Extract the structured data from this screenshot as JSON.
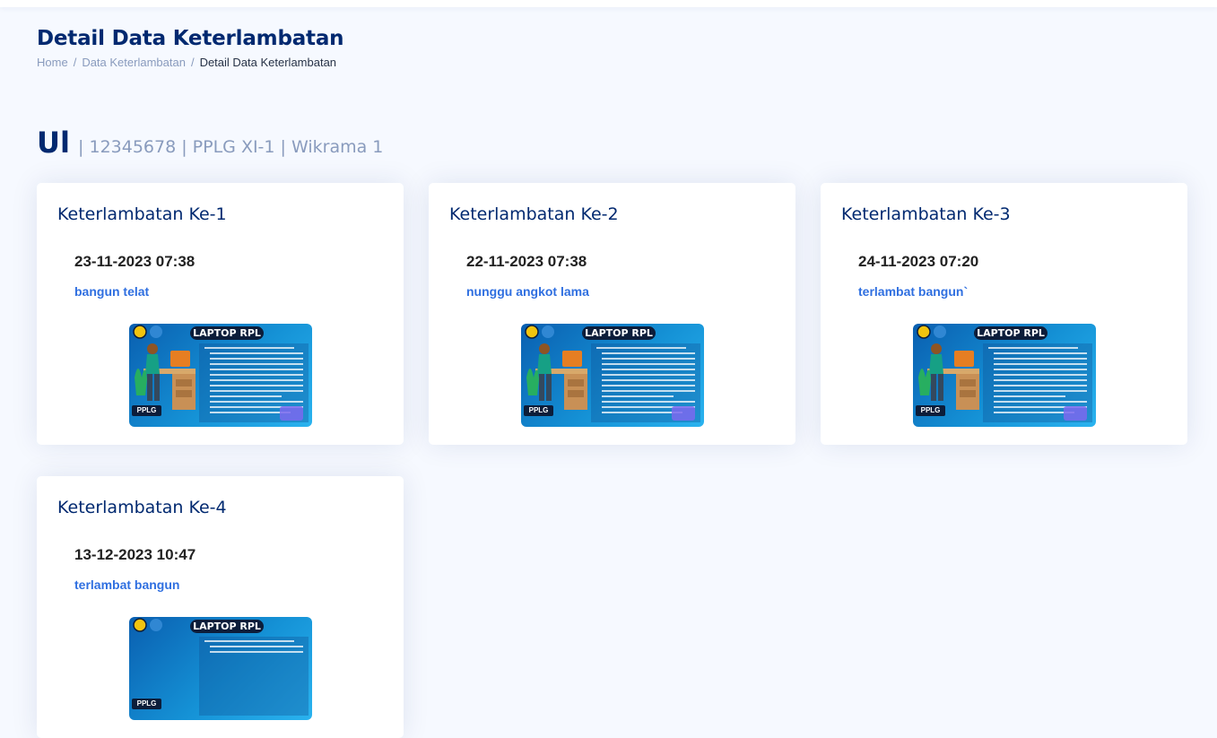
{
  "page": {
    "title": "Detail Data Keterlambatan",
    "breadcrumb": [
      "Home",
      "Data Keterlambatan",
      "Detail Data Keterlambatan"
    ]
  },
  "student": {
    "name": "Ul",
    "details": "| 12345678 | PPLG XI-1 | Wikrama 1"
  },
  "cards": [
    {
      "title": "Keterlambatan Ke-1",
      "datetime": "23-11-2023 07:38",
      "reason": "bangun telat",
      "image": {
        "title": "LAPTOP RPL",
        "tag": "PPLG"
      }
    },
    {
      "title": "Keterlambatan Ke-2",
      "datetime": "22-11-2023 07:38",
      "reason": "nunggu angkot lama",
      "image": {
        "title": "LAPTOP RPL",
        "tag": "PPLG"
      }
    },
    {
      "title": "Keterlambatan Ke-3",
      "datetime": "24-11-2023 07:20",
      "reason": "terlambat bangun`",
      "image": {
        "title": "LAPTOP RPL",
        "tag": "PPLG"
      }
    },
    {
      "title": "Keterlambatan Ke-4",
      "datetime": "13-12-2023 10:47",
      "reason": "terlambat bangun",
      "image": {
        "title": "LAPTOP RPL",
        "tag": "PPLG"
      }
    }
  ],
  "colors": {
    "background": "#f6f9ff",
    "heading": "#012970",
    "muted": "#899bbd",
    "reason": "#2f6fe0",
    "card": "#ffffff"
  }
}
